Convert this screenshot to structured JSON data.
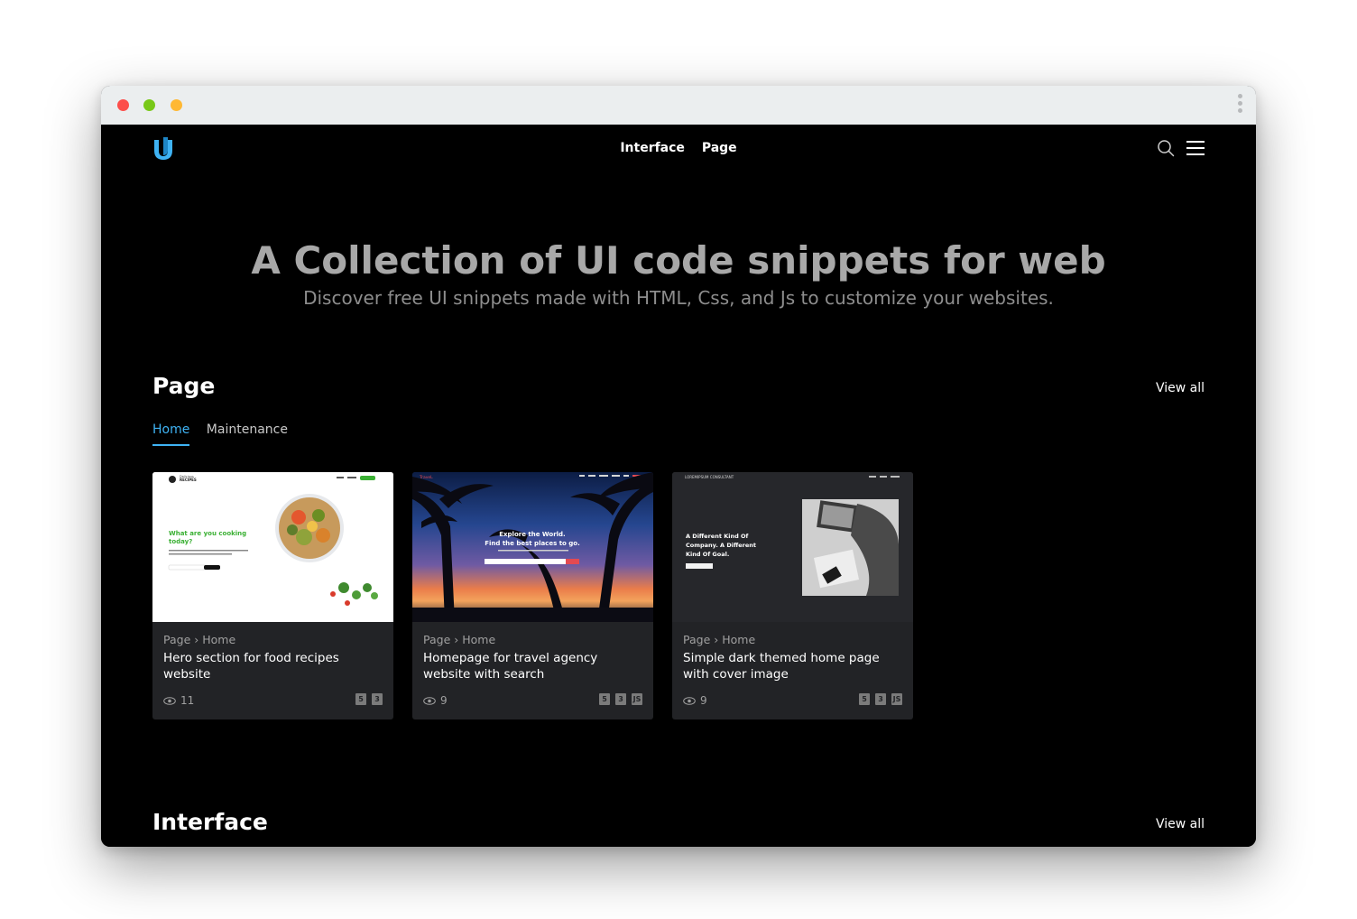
{
  "nav": {
    "items": [
      "Interface",
      "Page"
    ]
  },
  "hero": {
    "title": "A Collection of UI code snippets for web",
    "subtitle": "Discover free UI snippets made with HTML, Css, and Js to customize your websites."
  },
  "page_section": {
    "title": "Page",
    "view_all": "View all",
    "tabs": [
      {
        "label": "Home",
        "active": true
      },
      {
        "label": "Maintenance",
        "active": false
      }
    ],
    "cards": [
      {
        "crumb_section": "Page",
        "crumb_sep": "›",
        "crumb_sub": "Home",
        "title": "Hero section for food recipes website",
        "views": "11",
        "tech": [
          "5",
          "3"
        ],
        "thumb": {
          "brand": "RECIPES",
          "brand_small": "Delicious",
          "nav_cta": "Login",
          "headline_1": "What are you cooking",
          "headline_2": "today?",
          "body": "Explore easy recipes shared by the people around world or share your own recipe.",
          "input_placeholder": "Search recipe",
          "button": "Search"
        }
      },
      {
        "crumb_section": "Page",
        "crumb_sep": "›",
        "crumb_sub": "Home",
        "title": "Homepage for travel agency website with search",
        "views": "9",
        "tech": [
          "5",
          "3",
          "JS"
        ],
        "thumb": {
          "brand": "TraveL",
          "nav": [
            "Home",
            "About",
            "Packages",
            "Reviews",
            "Blog",
            "Contact"
          ],
          "headline_1": "Explore the World.",
          "headline_2": "Find the best places to go.",
          "body": "Lorem ipsum dolor sit amet, consectetur adipiscing elit.",
          "button": "Search"
        }
      },
      {
        "crumb_section": "Page",
        "crumb_sep": "›",
        "crumb_sub": "Home",
        "title": "Simple dark themed home page with cover image",
        "views": "9",
        "tech": [
          "5",
          "3",
          "JS"
        ],
        "thumb": {
          "brand": "LOREMIPSUM CONSULTANT",
          "nav": [
            "Home",
            "About",
            "Contact"
          ],
          "headline_1": "A Different Kind Of",
          "headline_2": "Company. A Different",
          "headline_3": "Kind Of Goal.",
          "button": "Get a Free Quote"
        }
      }
    ]
  },
  "interface_section": {
    "title": "Interface",
    "view_all": "View all"
  },
  "colors": {
    "accent": "#3fb3f4",
    "background": "#000000",
    "card": "#222326"
  }
}
